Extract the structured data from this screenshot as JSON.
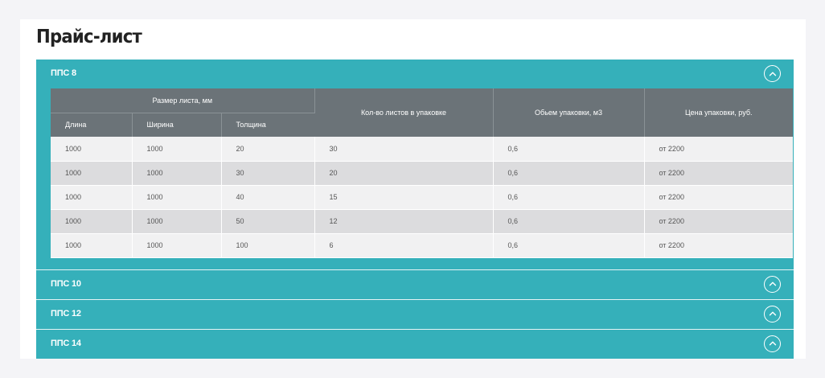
{
  "page": {
    "title": "Прайс-лист"
  },
  "colors": {
    "accent": "#35b0ba",
    "table_header": "#6b7378",
    "row_odd": "#f1f1f2",
    "row_even": "#dcdcde"
  },
  "accordion": [
    {
      "title": "ППС 8",
      "open": true,
      "toggle_icon": "chevron-up-icon",
      "table": {
        "group_header": "Размер листа, мм",
        "sub_headers": [
          "Длина",
          "Ширина",
          "Толщина"
        ],
        "headers": [
          "Кол-во листов в упаковке",
          "Обьем упаковки, м3",
          "Цена упаковки, руб."
        ],
        "rows": [
          [
            "1000",
            "1000",
            "20",
            "30",
            "0,6",
            "от 2200"
          ],
          [
            "1000",
            "1000",
            "30",
            "20",
            "0,6",
            "от 2200"
          ],
          [
            "1000",
            "1000",
            "40",
            "15",
            "0,6",
            "от 2200"
          ],
          [
            "1000",
            "1000",
            "50",
            "12",
            "0,6",
            "от 2200"
          ],
          [
            "1000",
            "1000",
            "100",
            "6",
            "0,6",
            "от 2200"
          ]
        ]
      }
    },
    {
      "title": "ППС 10",
      "open": false,
      "toggle_icon": "chevron-up-icon"
    },
    {
      "title": "ППС 12",
      "open": false,
      "toggle_icon": "chevron-up-icon"
    },
    {
      "title": "ППС 14",
      "open": false,
      "toggle_icon": "chevron-up-icon"
    }
  ]
}
